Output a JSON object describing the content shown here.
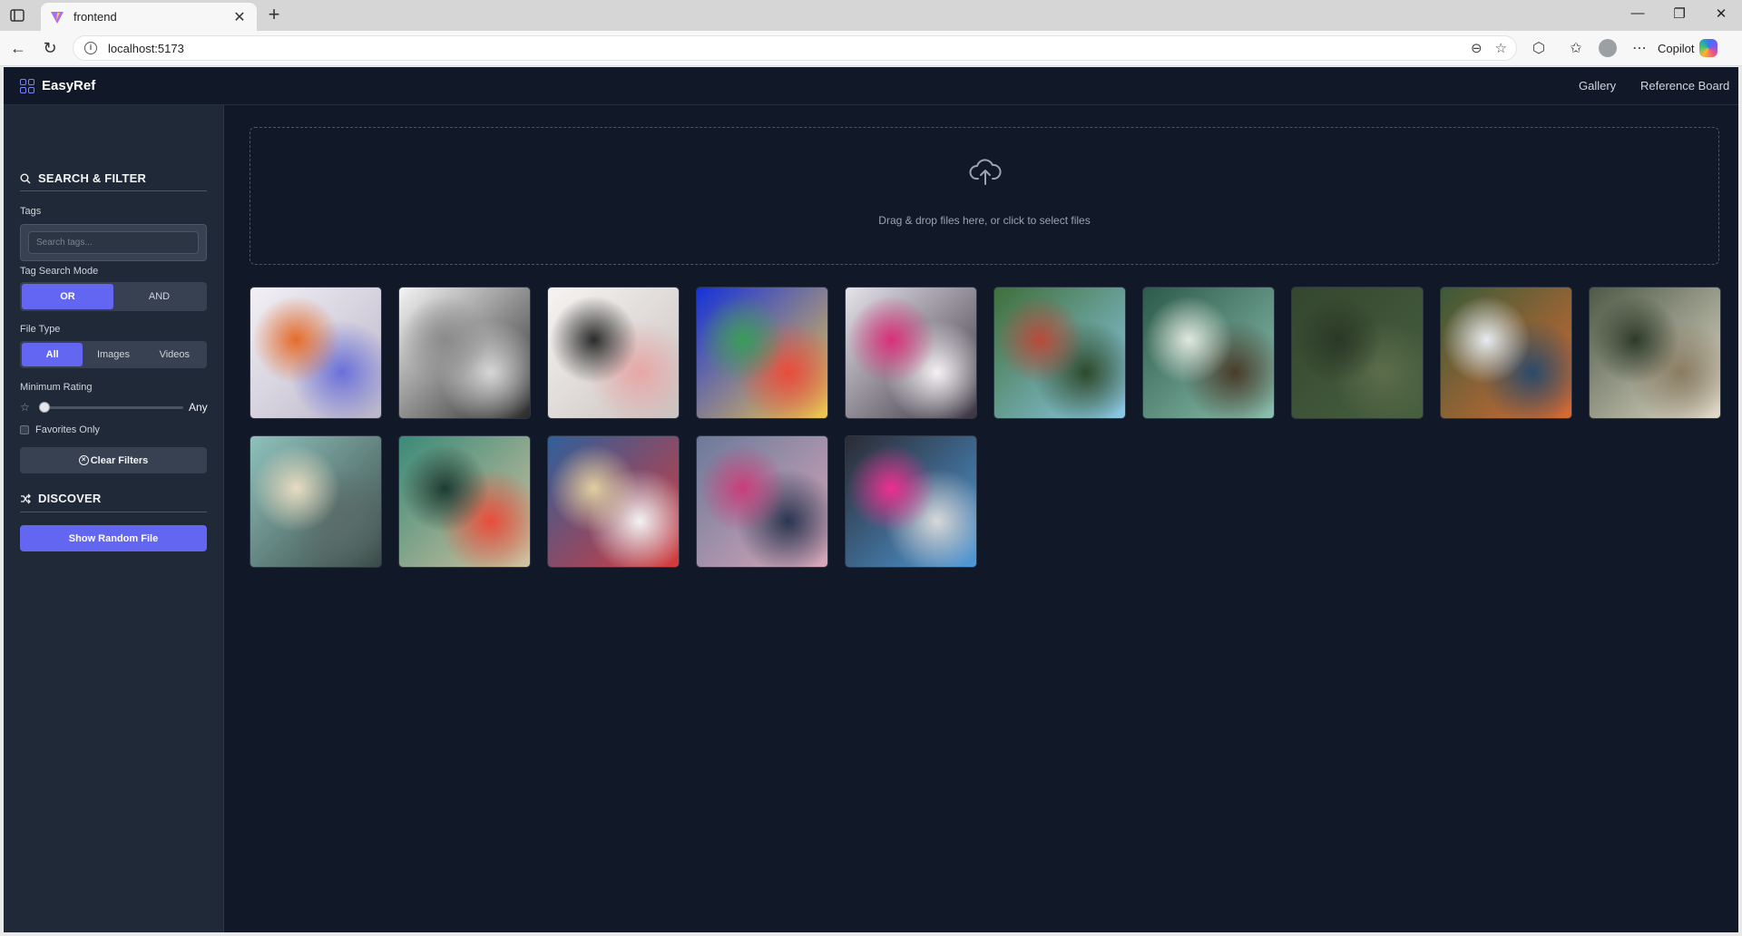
{
  "browser": {
    "tab_title": "frontend",
    "url": "localhost:5173",
    "copilot_label": "Copilot"
  },
  "app": {
    "brand": "EasyRef",
    "nav": {
      "gallery": "Gallery",
      "reference_board": "Reference Board"
    }
  },
  "sidebar": {
    "search_filter_title": "SEARCH & FILTER",
    "tags_label": "Tags",
    "tags_placeholder": "Search tags...",
    "tag_mode_label": "Tag Search Mode",
    "tag_mode_options": [
      "OR",
      "AND"
    ],
    "tag_mode_selected": "OR",
    "file_type_label": "File Type",
    "file_type_options": [
      "All",
      "Images",
      "Videos"
    ],
    "file_type_selected": "All",
    "min_rating_label": "Minimum Rating",
    "min_rating_value": "Any",
    "favorites_label": "Favorites Only",
    "favorites_checked": false,
    "clear_filters": "Clear Filters",
    "discover_title": "DISCOVER",
    "random_button": "Show Random File"
  },
  "main": {
    "dropzone_text": "Drag & drop files here, or click to select files",
    "thumbnail_count": 15,
    "thumbnails": [
      {
        "name": "thumb-1",
        "colors": [
          "#f3f0f5",
          "#b9b4c8",
          "#e56b2a",
          "#6a6fd8"
        ]
      },
      {
        "name": "thumb-2",
        "colors": [
          "#f4f4f4",
          "#2a2a2a",
          "#8b8b8b",
          "#d7d7d7"
        ]
      },
      {
        "name": "thumb-3",
        "colors": [
          "#f6f4f2",
          "#c9c2c0",
          "#2b2b2b",
          "#e7a6a6"
        ]
      },
      {
        "name": "thumb-4",
        "colors": [
          "#1431d9",
          "#f2c94c",
          "#3b9c5a",
          "#e94b3c"
        ]
      },
      {
        "name": "thumb-5",
        "colors": [
          "#e6e3ea",
          "#3a3340",
          "#d9307a",
          "#f5f1f3"
        ]
      },
      {
        "name": "thumb-6",
        "colors": [
          "#3f6f3a",
          "#8cc9e8",
          "#b84a3a",
          "#2e4a2b"
        ]
      },
      {
        "name": "thumb-7",
        "colors": [
          "#2d5a4a",
          "#8cc1b0",
          "#e1e8e0",
          "#4a3b2a"
        ]
      },
      {
        "name": "thumb-8",
        "colors": [
          "#34462f",
          "#48603f",
          "#2a3826",
          "#5c6d4b"
        ]
      },
      {
        "name": "thumb-9",
        "colors": [
          "#3a5a38",
          "#d96a32",
          "#e6ecf2",
          "#2a4a6a"
        ]
      },
      {
        "name": "thumb-10",
        "colors": [
          "#4d5946",
          "#e3dccb",
          "#2f3b2a",
          "#8a7c62"
        ]
      },
      {
        "name": "thumb-11",
        "colors": [
          "#8fc2bd",
          "#3b4a46",
          "#e8dcc0",
          "#5b6c6a"
        ]
      },
      {
        "name": "thumb-12",
        "colors": [
          "#3a8a78",
          "#d3c2a0",
          "#1f3b33",
          "#e84d3a"
        ]
      },
      {
        "name": "thumb-13",
        "colors": [
          "#2f5f9a",
          "#d83a3a",
          "#e2cfa0",
          "#f3f3f3"
        ]
      },
      {
        "name": "thumb-14",
        "colors": [
          "#6b7a9a",
          "#d9a7b8",
          "#c83e7a",
          "#2b3550"
        ]
      },
      {
        "name": "thumb-15",
        "colors": [
          "#2b2b33",
          "#4f9ad9",
          "#ee2f8f",
          "#d8d8d8"
        ]
      }
    ]
  },
  "colors": {
    "accent": "#6366f1",
    "sidebar_bg": "#1f2937",
    "app_bg": "#111827"
  }
}
